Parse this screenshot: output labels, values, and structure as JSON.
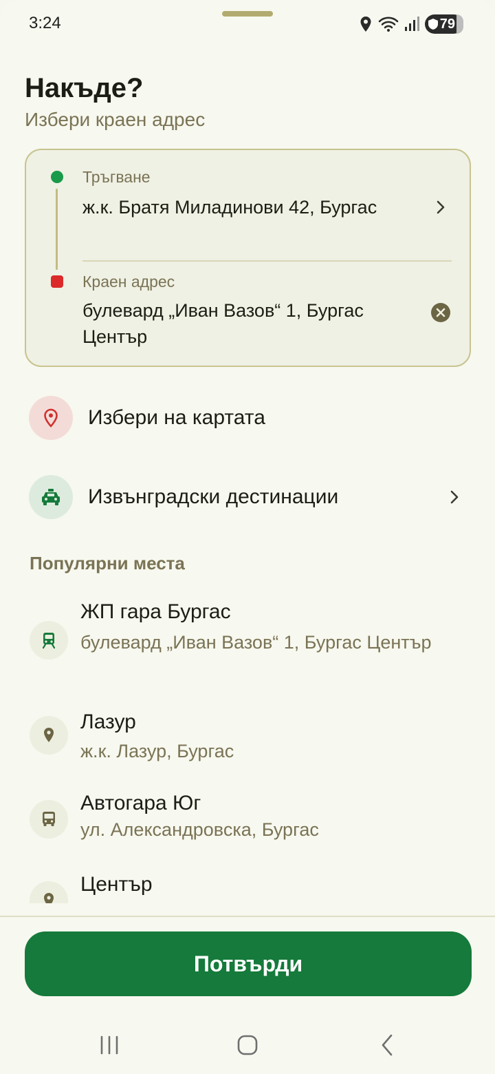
{
  "status": {
    "time": "3:24",
    "battery": "79",
    "icons": [
      "location-icon",
      "wifi-icon",
      "signal-icon",
      "battery-icon"
    ]
  },
  "header": {
    "title": "Накъде?",
    "subtitle": "Избери краен адрес"
  },
  "route": {
    "origin_label": "Тръгване",
    "origin_value": "ж.к. Братя Миладинови 42, Бургас",
    "destination_label": "Краен адрес",
    "destination_value": "булевард „Иван Вазов“ 1, Бургас Център"
  },
  "actions": {
    "pick_on_map": "Избери на картата",
    "outside_city": "Извънградски дестинации"
  },
  "popular": {
    "title": "Популярни места",
    "items": [
      {
        "name": "ЖП гара Бургас",
        "address": "булевард „Иван Вазов“ 1, Бургас Център",
        "icon": "train-icon"
      },
      {
        "name": "Лазур",
        "address": "ж.к. Лазур, Бургас",
        "icon": "location-pin-icon"
      },
      {
        "name": "Автогара Юг",
        "address": "ул. Александровска, Бургас",
        "icon": "bus-icon"
      },
      {
        "name": "Център",
        "address": "",
        "icon": "location-pin-icon"
      }
    ]
  },
  "confirm_label": "Потвърди",
  "colors": {
    "accent": "#157a3b",
    "origin_dot": "#1a9a4b",
    "destination_dot": "#db2a2a",
    "muted_text": "#7a7355"
  }
}
